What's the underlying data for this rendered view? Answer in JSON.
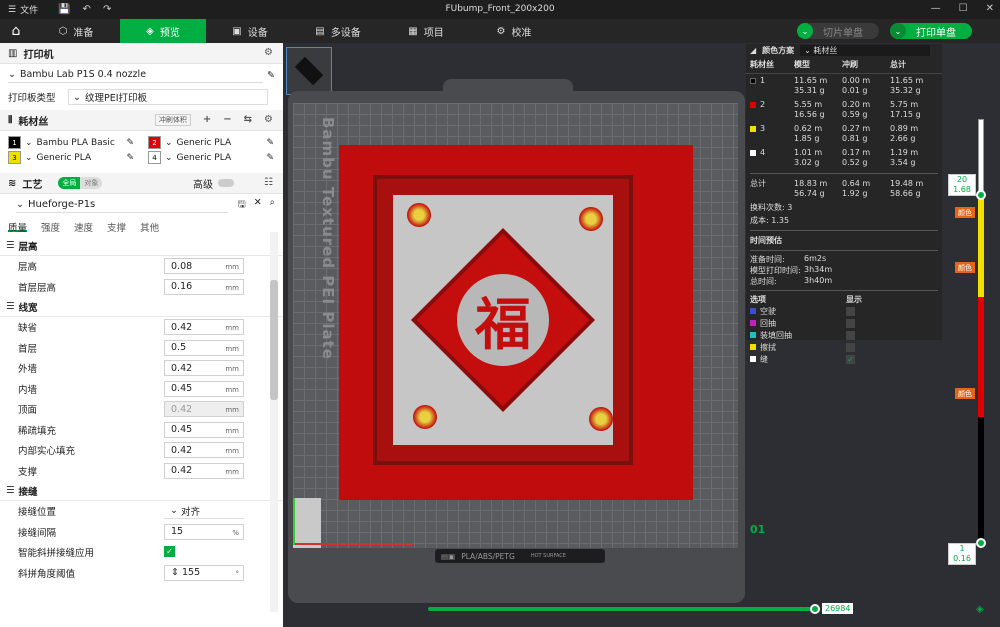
{
  "title": "FUbump_Front_200x200",
  "menu": {
    "file": "文件"
  },
  "tabs": [
    {
      "label": "准备"
    },
    {
      "label": "预览"
    },
    {
      "label": "设备"
    },
    {
      "label": "多设备"
    },
    {
      "label": "项目"
    },
    {
      "label": "校准"
    }
  ],
  "buttons": {
    "slice": "切片单盘",
    "print": "打印单盘"
  },
  "printer": {
    "section": "打印机",
    "name": "Bambu Lab P1S 0.4 nozzle",
    "plate_type_label": "打印板类型",
    "plate_type": "纹理PEI打印板"
  },
  "filament": {
    "section": "耗材丝",
    "flush_label": "冲刷体积",
    "slots": [
      {
        "num": "1",
        "name": "Bambu PLA Basic",
        "color": "#000000"
      },
      {
        "num": "2",
        "name": "Generic PLA",
        "color": "#e00000"
      },
      {
        "num": "3",
        "name": "Generic PLA",
        "color": "#f0e000"
      },
      {
        "num": "4",
        "name": "Generic PLA",
        "color": "#ffffff"
      }
    ]
  },
  "process": {
    "section": "工艺",
    "toggle_global": "全局",
    "toggle_object": "对象",
    "advanced": "高级",
    "preset": "Hueforge-P1s",
    "subtabs": [
      "质量",
      "强度",
      "速度",
      "支撑",
      "其他"
    ],
    "groups": {
      "layer": {
        "title": "层高",
        "params": [
          {
            "label": "层高",
            "value": "0.08",
            "unit": "mm"
          },
          {
            "label": "首层层高",
            "value": "0.16",
            "unit": "mm"
          }
        ]
      },
      "width": {
        "title": "线宽",
        "params": [
          {
            "label": "缺省",
            "value": "0.42",
            "unit": "mm"
          },
          {
            "label": "首层",
            "value": "0.5",
            "unit": "mm"
          },
          {
            "label": "外墙",
            "value": "0.42",
            "unit": "mm"
          },
          {
            "label": "内墙",
            "value": "0.45",
            "unit": "mm"
          },
          {
            "label": "顶面",
            "value": "0.42",
            "unit": "mm"
          },
          {
            "label": "稀疏填充",
            "value": "0.45",
            "unit": "mm"
          },
          {
            "label": "内部实心填充",
            "value": "0.42",
            "unit": "mm"
          },
          {
            "label": "支撑",
            "value": "0.42",
            "unit": "mm"
          }
        ]
      },
      "seam": {
        "title": "接缝",
        "params": [
          {
            "label": "接缝位置",
            "value": "对齐",
            "unit": ""
          },
          {
            "label": "接缝间隔",
            "value": "15",
            "unit": "%"
          },
          {
            "label": "智能斜拼接缝应用",
            "value": "",
            "unit": ""
          },
          {
            "label": "斜拼角度阈值",
            "value": "155",
            "unit": "°"
          }
        ]
      }
    }
  },
  "viewport": {
    "plate_label": "Bambu Textured PEI Plate",
    "plate_bottom": "PLA/ABS/PETG",
    "hot_surface": "HOT SURFACE",
    "plate_num": "01",
    "character": "福"
  },
  "legend": {
    "scheme_label": "颜色方案",
    "scheme": "耗材丝",
    "headers": [
      "耗材丝",
      "模型",
      "冲刷",
      "总计"
    ],
    "rows": [
      {
        "id": "1",
        "color": "#000000",
        "model": "11.65 m",
        "model_g": "35.31 g",
        "flush": "0.00 m",
        "flush_g": "0.01 g",
        "total": "11.65 m",
        "total_g": "35.32 g"
      },
      {
        "id": "2",
        "color": "#e00000",
        "model": "5.55 m",
        "model_g": "16.56 g",
        "flush": "0.20 m",
        "flush_g": "0.59 g",
        "total": "5.75 m",
        "total_g": "17.15 g"
      },
      {
        "id": "3",
        "color": "#f0e000",
        "model": "0.62 m",
        "model_g": "1.85 g",
        "flush": "0.27 m",
        "flush_g": "0.81 g",
        "total": "0.89 m",
        "total_g": "2.66 g"
      },
      {
        "id": "4",
        "color": "#ffffff",
        "model": "1.01 m",
        "model_g": "3.02 g",
        "flush": "0.17 m",
        "flush_g": "0.52 g",
        "total": "1.19 m",
        "total_g": "3.54 g"
      }
    ],
    "sum": {
      "label": "总计",
      "model": "18.83 m",
      "model_g": "56.74 g",
      "flush": "0.64 m",
      "flush_g": "1.92 g",
      "total": "19.48 m",
      "total_g": "58.66 g"
    },
    "changes": "换料次数: 3",
    "cost": "成本: 1.35",
    "time_title": "时间预估",
    "prep_label": "准备时间:",
    "prep": "6m2s",
    "model_time_label": "模型打印时间:",
    "model_time": "3h34m",
    "total_time_label": "总时间:",
    "total_time": "3h40m",
    "options_label": "选项",
    "display_label": "显示",
    "options": [
      {
        "label": "空驶",
        "color": "#3a4fd0"
      },
      {
        "label": "回抽",
        "color": "#c020c0"
      },
      {
        "label": "装填回抽",
        "color": "#20c0c0"
      },
      {
        "label": "擦拭",
        "color": "#f0e000"
      },
      {
        "label": "缝",
        "color": "#ffffff"
      }
    ]
  },
  "layer_slider": {
    "top_layer": "20",
    "top_height": "1.68",
    "bottom_layer": "1",
    "bottom_height": "0.16",
    "color_tag": "颜色"
  },
  "move_slider": {
    "value": "26984"
  }
}
